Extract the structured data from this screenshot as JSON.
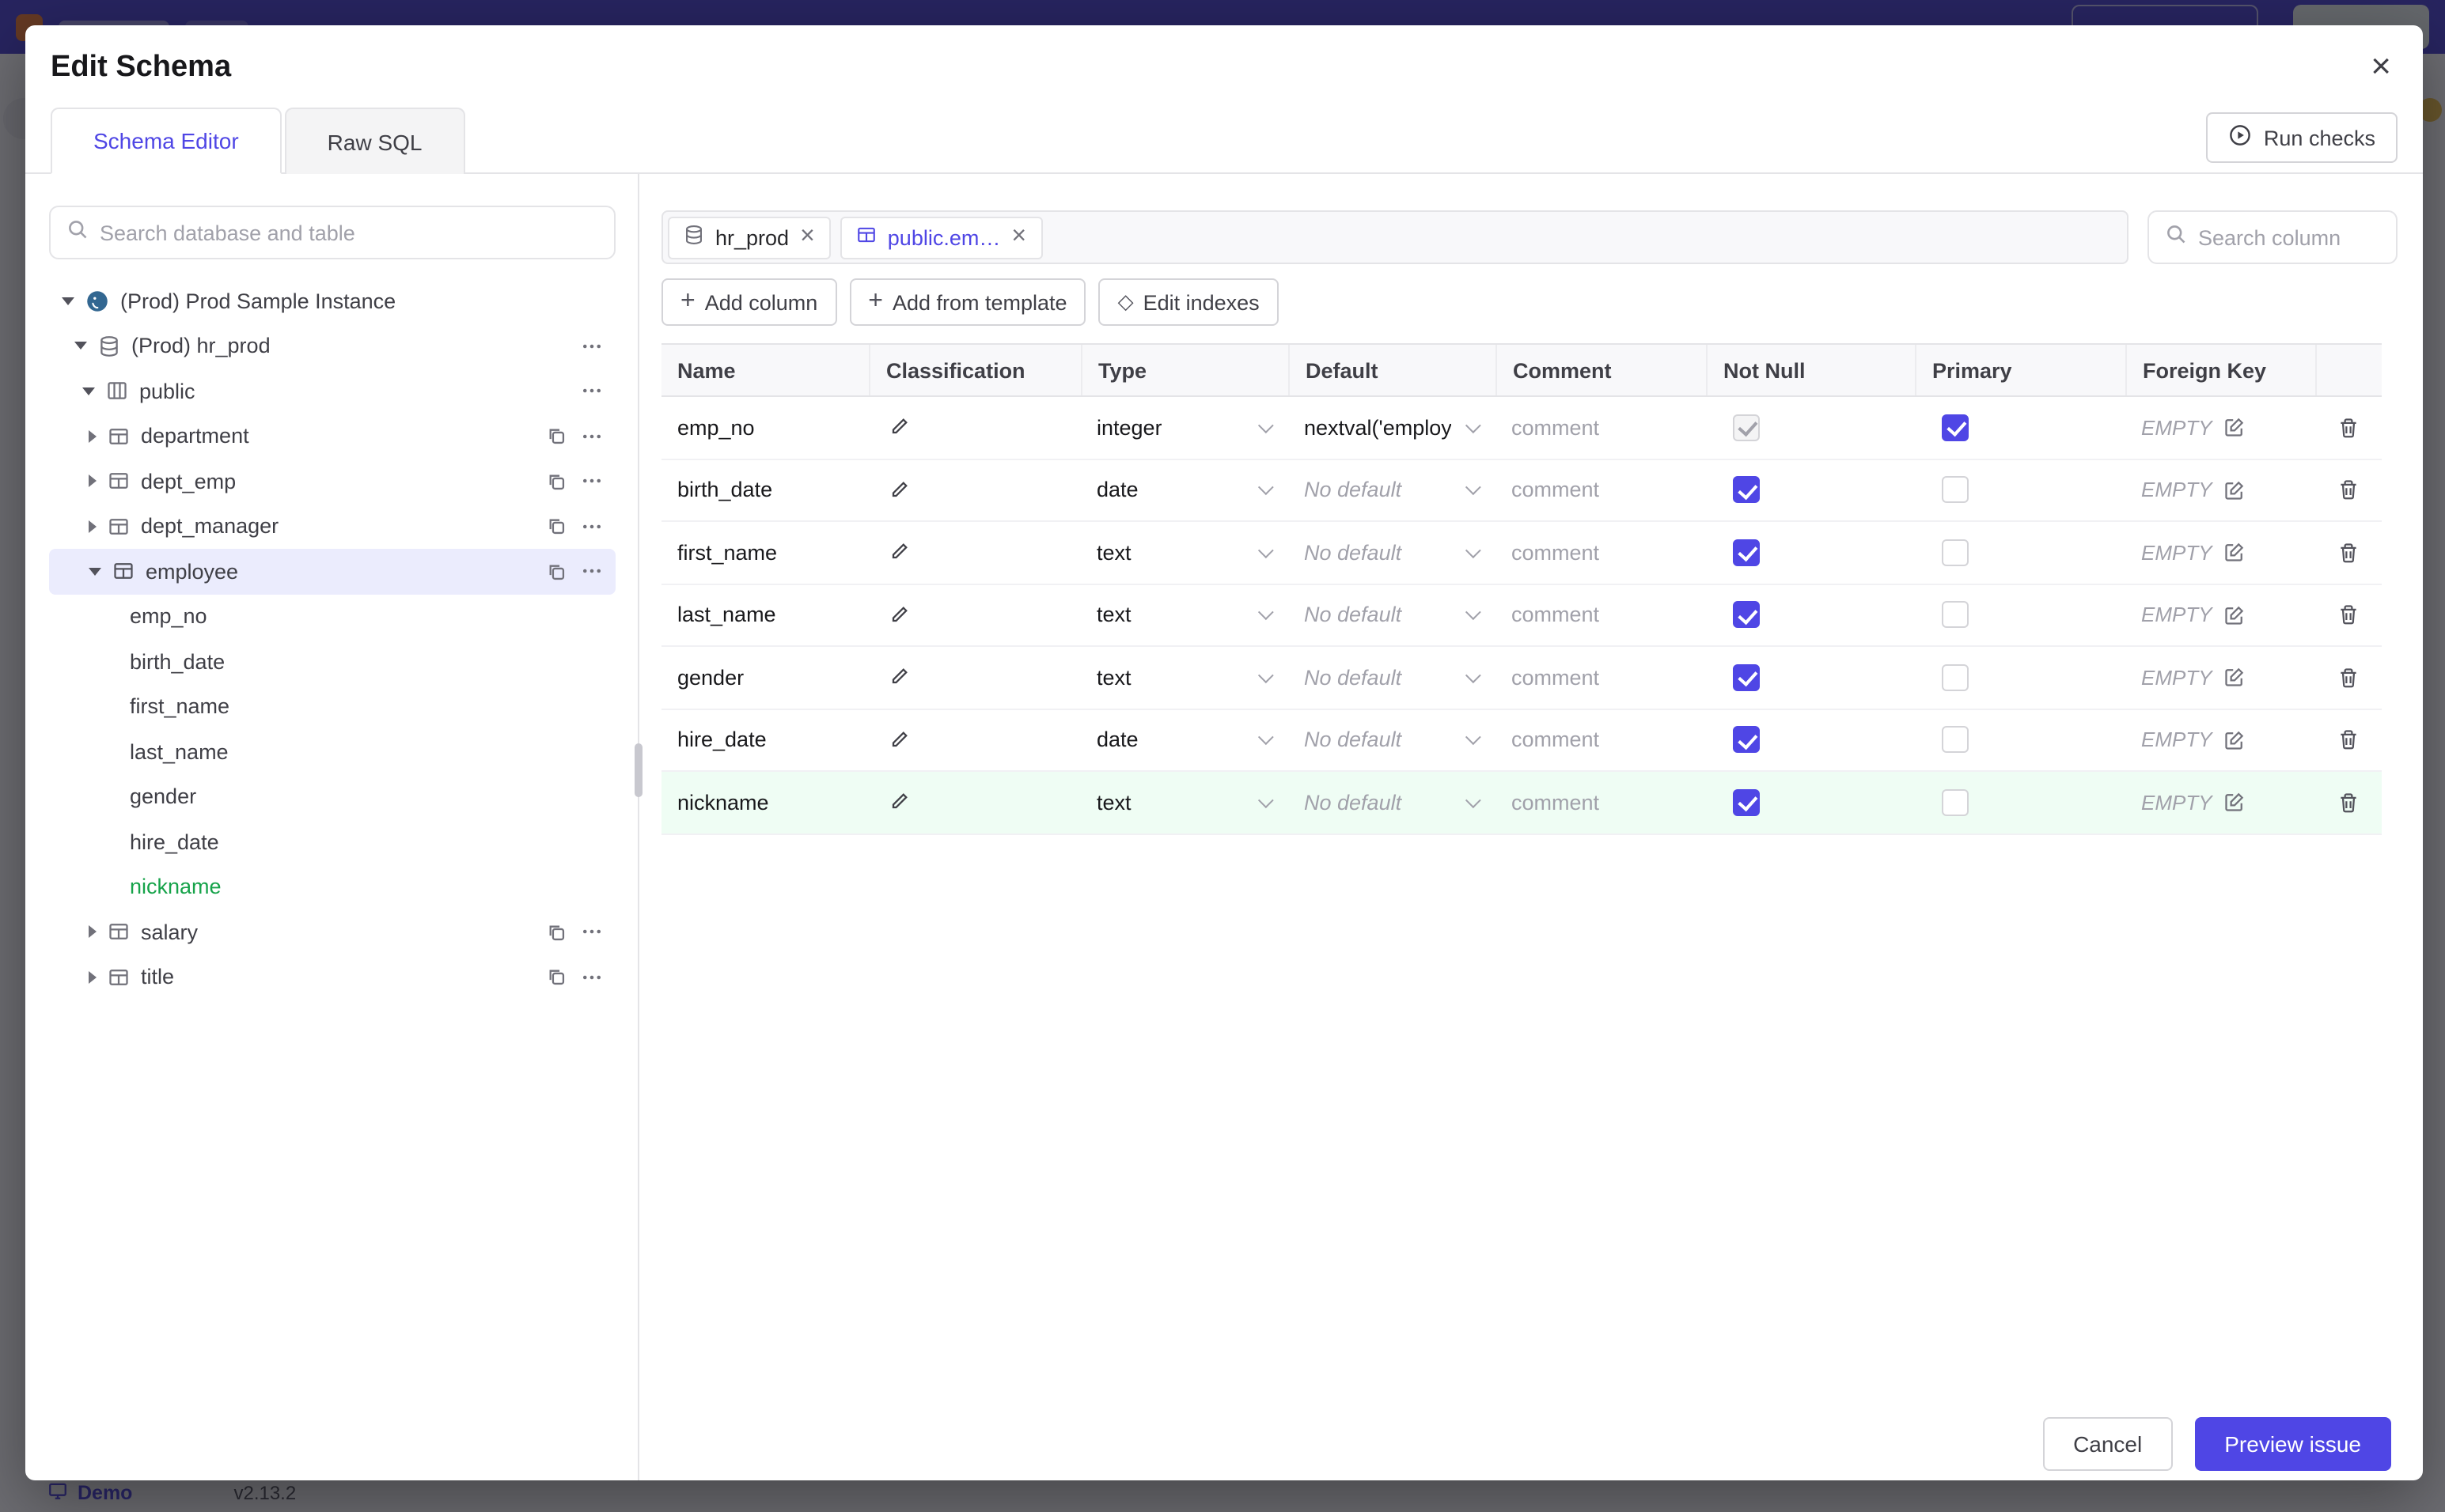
{
  "backdrop": {
    "demo_label": "Demo",
    "version": "v2.13.2"
  },
  "modal": {
    "title": "Edit Schema",
    "close_glyph": "×",
    "tabs": {
      "schema_editor": "Schema Editor",
      "raw_sql": "Raw SQL"
    },
    "run_checks_label": "Run checks",
    "footer": {
      "cancel_label": "Cancel",
      "submit_label": "Preview issue"
    }
  },
  "sidebar": {
    "search_placeholder": "Search database and table",
    "tree": [
      {
        "label": "(Prod) Prod Sample Instance",
        "icon": "instance",
        "expanded": true
      },
      {
        "label": "(Prod) hr_prod",
        "icon": "database",
        "expanded": true,
        "menu": true
      },
      {
        "label": "public",
        "icon": "schema",
        "expanded": true,
        "menu": true
      },
      {
        "label": "department",
        "icon": "table",
        "expanded": false,
        "copy": true,
        "menu": true
      },
      {
        "label": "dept_emp",
        "icon": "table",
        "expanded": false,
        "copy": true,
        "menu": true
      },
      {
        "label": "dept_manager",
        "icon": "table",
        "expanded": false,
        "copy": true,
        "menu": true
      },
      {
        "label": "employee",
        "icon": "table",
        "expanded": true,
        "selected": true,
        "copy": true,
        "menu": true
      },
      {
        "label": "emp_no",
        "kind": "column"
      },
      {
        "label": "birth_date",
        "kind": "column"
      },
      {
        "label": "first_name",
        "kind": "column"
      },
      {
        "label": "last_name",
        "kind": "column"
      },
      {
        "label": "gender",
        "kind": "column"
      },
      {
        "label": "hire_date",
        "kind": "column"
      },
      {
        "label": "nickname",
        "kind": "column",
        "state": "new",
        "color": "#16a34a"
      },
      {
        "label": "salary",
        "icon": "table",
        "expanded": false,
        "copy": true,
        "menu": true
      },
      {
        "label": "title",
        "icon": "table",
        "expanded": false,
        "copy": true,
        "menu": true
      }
    ]
  },
  "main": {
    "chips": [
      {
        "label": "hr_prod",
        "icon": "database",
        "active": false
      },
      {
        "label": "public.em…",
        "icon": "table",
        "active": true
      }
    ],
    "column_search_placeholder": "Search column",
    "toolbar": {
      "add_column": "Add column",
      "add_from_template": "Add from template",
      "edit_indexes": "Edit indexes"
    },
    "table": {
      "headers": [
        "Name",
        "Classification",
        "Type",
        "Default",
        "Comment",
        "Not Null",
        "Primary",
        "Foreign Key"
      ],
      "comment_placeholder": "comment",
      "rows": [
        {
          "name": "emp_no",
          "type": "integer",
          "default": "nextval('employ",
          "default_muted": false,
          "not_null_checked": true,
          "not_null_disabled": true,
          "primary_checked": true,
          "foreign_key": "EMPTY",
          "highlight": false
        },
        {
          "name": "birth_date",
          "type": "date",
          "default": "No default",
          "default_muted": true,
          "not_null_checked": true,
          "not_null_disabled": false,
          "primary_checked": false,
          "foreign_key": "EMPTY",
          "highlight": false
        },
        {
          "name": "first_name",
          "type": "text",
          "default": "No default",
          "default_muted": true,
          "not_null_checked": true,
          "not_null_disabled": false,
          "primary_checked": false,
          "foreign_key": "EMPTY",
          "highlight": false
        },
        {
          "name": "last_name",
          "type": "text",
          "default": "No default",
          "default_muted": true,
          "not_null_checked": true,
          "not_null_disabled": false,
          "primary_checked": false,
          "foreign_key": "EMPTY",
          "highlight": false
        },
        {
          "name": "gender",
          "type": "text",
          "default": "No default",
          "default_muted": true,
          "not_null_checked": true,
          "not_null_disabled": false,
          "primary_checked": false,
          "foreign_key": "EMPTY",
          "highlight": false
        },
        {
          "name": "hire_date",
          "type": "date",
          "default": "No default",
          "default_muted": true,
          "not_null_checked": true,
          "not_null_disabled": false,
          "primary_checked": false,
          "foreign_key": "EMPTY",
          "highlight": false
        },
        {
          "name": "nickname",
          "type": "text",
          "default": "No default",
          "default_muted": true,
          "not_null_checked": true,
          "not_null_disabled": false,
          "primary_checked": false,
          "foreign_key": "EMPTY",
          "highlight": true
        }
      ]
    }
  },
  "colors": {
    "accent": "#4f46e5",
    "new_item_green": "#16a34a",
    "highlight_row_green": "#effdf4",
    "selected_tree_bg": "#ebecfd"
  }
}
